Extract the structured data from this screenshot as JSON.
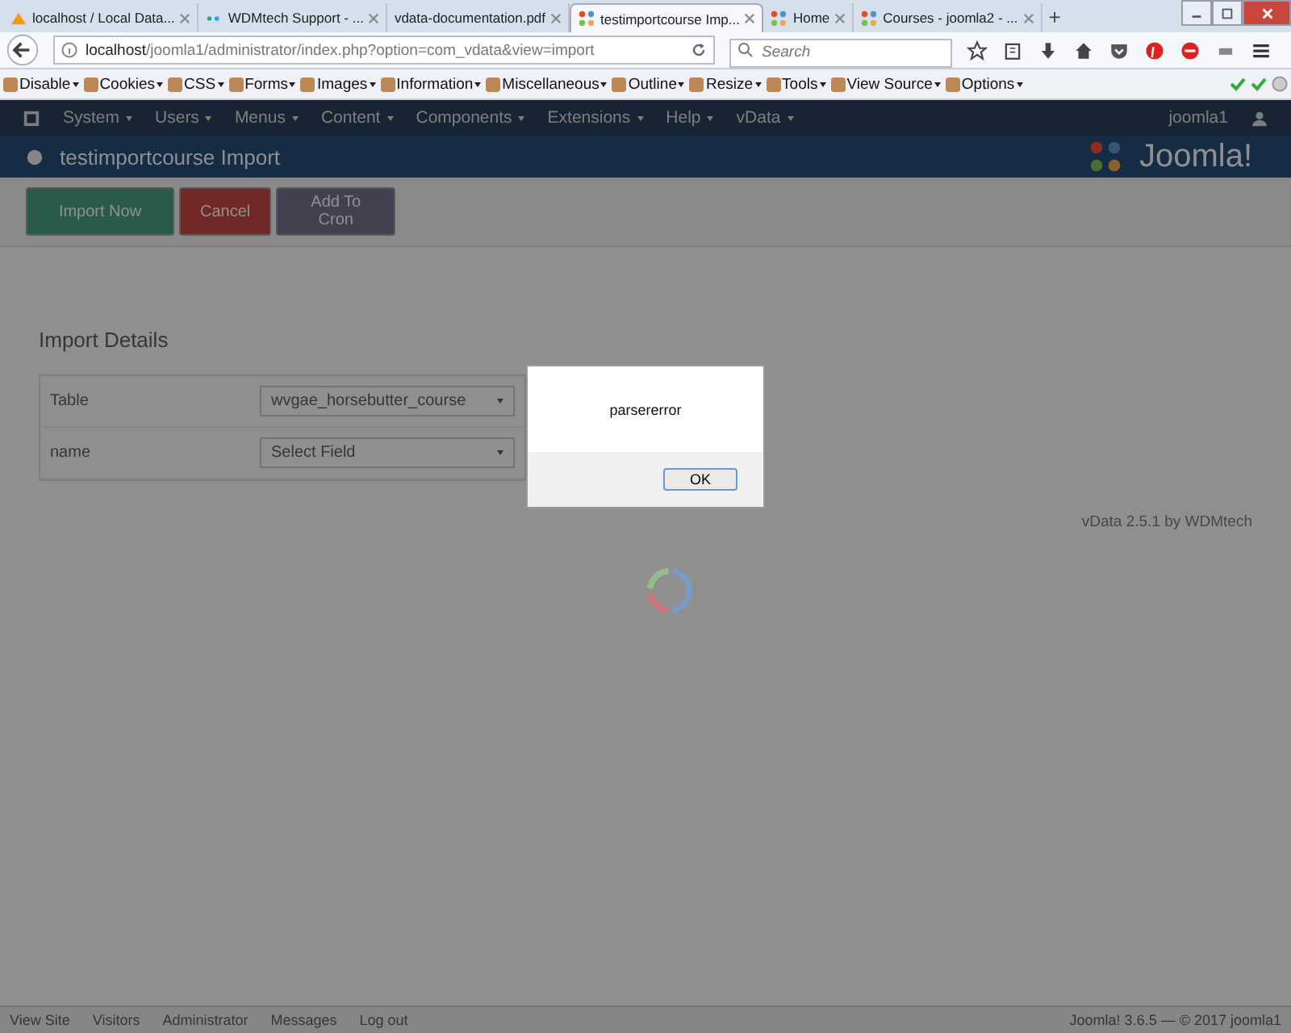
{
  "browser": {
    "tabs": [
      {
        "title": "localhost / Local Data...",
        "selected": false
      },
      {
        "title": "WDMtech Support - ...",
        "selected": false
      },
      {
        "title": "vdata-documentation.pdf",
        "selected": false
      },
      {
        "title": "testimportcourse Imp...",
        "selected": true
      },
      {
        "title": "Home",
        "selected": false
      },
      {
        "title": "Courses - joomla2 - ...",
        "selected": false
      }
    ],
    "new_tab": "+",
    "url_host": "localhost",
    "url_path": "/joomla1/administrator/index.php?option=com_vdata&view=import",
    "search": {
      "placeholder": "Search"
    },
    "devtools": [
      "Disable",
      "Cookies",
      "CSS",
      "Forms",
      "Images",
      "Information",
      "Miscellaneous",
      "Outline",
      "Resize",
      "Tools",
      "View Source",
      "Options"
    ]
  },
  "admin": {
    "menu": [
      "System",
      "Users",
      "Menus",
      "Content",
      "Components",
      "Extensions",
      "Help",
      "vData"
    ],
    "user": "joomla1",
    "page_title": "testimportcourse Import",
    "logo": "Joomla!",
    "toolbar": [
      {
        "label": "Import Now",
        "kind": "success"
      },
      {
        "label": "Cancel",
        "kind": "danger"
      },
      {
        "label": "Add To Cron",
        "kind": "default"
      }
    ],
    "section_title": "Import Details",
    "fields": [
      {
        "label": "Table",
        "value": "wvgae_horsebutter_course"
      },
      {
        "label": "name",
        "value": "Select Field"
      }
    ],
    "credit": "vData 2.5.1 by WDMtech",
    "status": [
      "View Site",
      "Visitors",
      "Administrator",
      "Messages",
      "Log out"
    ],
    "copyright": "Joomla! 3.6.5 — © 2017 joomla1"
  },
  "dialog": {
    "message": "parsererror",
    "button": "OK"
  }
}
